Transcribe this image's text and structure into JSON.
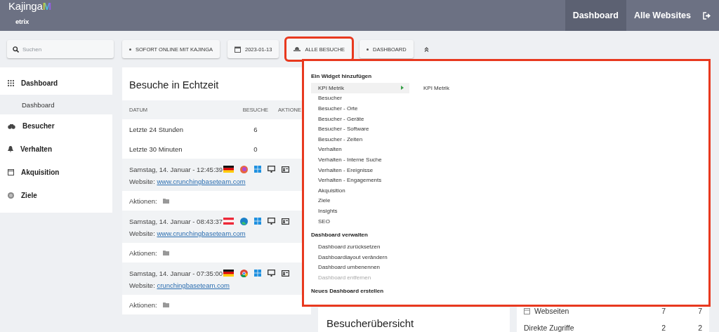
{
  "header": {
    "logo": {
      "left": "Kajinga",
      "mark": "M",
      "right": "etrix"
    },
    "nav": [
      {
        "label": "Dashboard",
        "selected": true
      },
      {
        "label": "Alle Websites",
        "selected": false
      }
    ]
  },
  "toolbar": {
    "search": {
      "placeholder": "Suchen"
    },
    "buttons": [
      {
        "kind": "dot",
        "label": "SOFORT ONLINE MIT KAJINGA",
        "outlined": false
      },
      {
        "kind": "date",
        "label": "2023-01-13",
        "outlined": false
      },
      {
        "kind": "segment",
        "label": "ALLE BESUCHE",
        "outlined": true
      },
      {
        "kind": "dot",
        "label": "DASHBOARD",
        "outlined": false
      }
    ]
  },
  "sidebar": {
    "items": [
      {
        "kind": "grid",
        "label": "Dashboard",
        "children": [
          {
            "label": "Dashboard",
            "selected": true
          }
        ]
      },
      {
        "kind": "binoculars",
        "label": "Besucher"
      },
      {
        "kind": "bell",
        "label": "Verhalten"
      },
      {
        "kind": "window",
        "label": "Akquisition"
      },
      {
        "kind": "target",
        "label": "Ziele"
      }
    ]
  },
  "realtime": {
    "title": "Besuche in Echtzeit",
    "columns": [
      "DATUM",
      "BESUCHE",
      "AKTIONE"
    ],
    "rows": [
      {
        "period": "Letzte 24 Stunden",
        "visits": "6"
      },
      {
        "period": "Letzte 30 Minuten",
        "visits": "0"
      }
    ],
    "visits": [
      {
        "date": "Samstag, 14. Januar - 12:45:39",
        "icons": [
          {
            "kind": "flag-de"
          },
          {
            "kind": "firefox"
          }
        ],
        "website_label": "Website:",
        "website": "www.crunchingbaseteam.com",
        "actions_label": "Aktionen:"
      },
      {
        "date": "Samstag, 14. Januar - 08:43:37",
        "icons": [
          {
            "kind": "flag-at"
          },
          {
            "kind": "edge"
          }
        ],
        "website_label": "Website:",
        "website": "www.crunchingbaseteam.com",
        "actions_label": "Aktionen:"
      },
      {
        "date": "Samstag, 14. Januar - 07:35:00",
        "icons": [
          {
            "kind": "flag-de"
          },
          {
            "kind": "chrome"
          }
        ],
        "website_label": "Website:",
        "website": "crunchingbaseteam.com",
        "actions_label": "Aktionen:"
      }
    ]
  },
  "overview": {
    "title": "Besucherübersicht"
  },
  "channels": {
    "rows": [
      {
        "label": "Webseiten",
        "value_1": "7",
        "value_2": "7",
        "icon": true
      },
      {
        "label": "Direkte Zugriffe",
        "value_1": "2",
        "value_2": "2",
        "icon": false
      }
    ]
  },
  "dropdown": {
    "outlined": true,
    "sections": [
      {
        "title": "Ein Widget hinzufügen",
        "items": [
          {
            "label": "KPI Metrik",
            "selected": true,
            "disabled": false,
            "submenu": "KPI Metrik"
          },
          {
            "label": "Besucher",
            "selected": false,
            "disabled": false
          },
          {
            "label": "Besucher - Orte",
            "selected": false,
            "disabled": false
          },
          {
            "label": "Besucher - Geräte",
            "selected": false,
            "disabled": false
          },
          {
            "label": "Besucher - Software",
            "selected": false,
            "disabled": false
          },
          {
            "label": "Besucher - Zeiten",
            "selected": false,
            "disabled": false
          },
          {
            "label": "Verhalten",
            "selected": false,
            "disabled": false
          },
          {
            "label": "Verhalten - Interne Suche",
            "selected": false,
            "disabled": false
          },
          {
            "label": "Verhalten - Ereignisse",
            "selected": false,
            "disabled": false
          },
          {
            "label": "Verhalten - Engagements",
            "selected": false,
            "disabled": false
          },
          {
            "label": "Akquisition",
            "selected": false,
            "disabled": false
          },
          {
            "label": "Ziele",
            "selected": false,
            "disabled": false
          },
          {
            "label": "Insights",
            "selected": false,
            "disabled": false
          },
          {
            "label": "SEO",
            "selected": false,
            "disabled": false
          }
        ]
      },
      {
        "title": "Dashboard verwalten",
        "items": [
          {
            "label": "Dashboard zurücksetzen",
            "selected": false,
            "disabled": false
          },
          {
            "label": "Dashboardlayout verändern",
            "selected": false,
            "disabled": false
          },
          {
            "label": "Dashboard umbenennen",
            "selected": false,
            "disabled": false
          },
          {
            "label": "Dashboard entfernen",
            "selected": false,
            "disabled": true
          }
        ]
      },
      {
        "title": "Neues Dashboard erstellen"
      }
    ]
  }
}
